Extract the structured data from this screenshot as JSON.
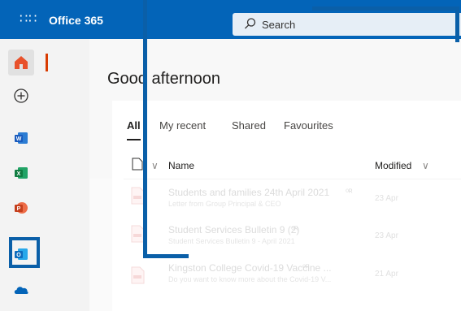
{
  "topbar": {
    "app_title": "Office 365",
    "waffle_icon": "waffle-icon",
    "search_placeholder": "Search",
    "color": "#0364b8"
  },
  "rail": {
    "items": [
      "home",
      "create",
      "word",
      "excel",
      "powerpoint",
      "outlook",
      "onedrive"
    ]
  },
  "main": {
    "greeting": "Good afternoon",
    "tabs": [
      "All",
      "My recent",
      "Shared",
      "Favourites"
    ],
    "columns": {
      "name": "Name",
      "modified": "Modified"
    },
    "files": [
      {
        "name": "Students and families 24th April 2021",
        "subtitle": "Letter from Group Principal & CEO",
        "modified": "23 Apr"
      },
      {
        "name": "Student Services Bulletin 9 (2)",
        "subtitle": "Student Services Bulletin 9 - April 2021",
        "modified": "23 Apr"
      },
      {
        "name": "Kingston College Covid-19 Vaccine ...",
        "subtitle": "Do you want to know more about the Covid-19 V...",
        "modified": "21 Apr"
      }
    ]
  },
  "highlight_color": "#0a5fa8"
}
